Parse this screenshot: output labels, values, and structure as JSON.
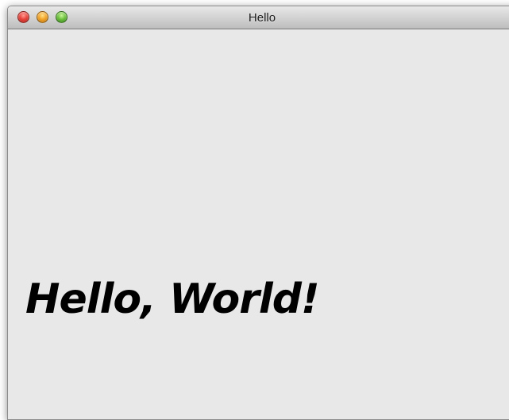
{
  "window": {
    "title": "Hello",
    "controls": [
      {
        "name": "close",
        "icon": "close-icon",
        "color": "#e8443b"
      },
      {
        "name": "minimize",
        "icon": "minimize-icon",
        "color": "#f2a52a"
      },
      {
        "name": "zoom",
        "icon": "zoom-icon",
        "color": "#6ec23f"
      }
    ]
  },
  "content": {
    "label": "Hello, World!"
  }
}
